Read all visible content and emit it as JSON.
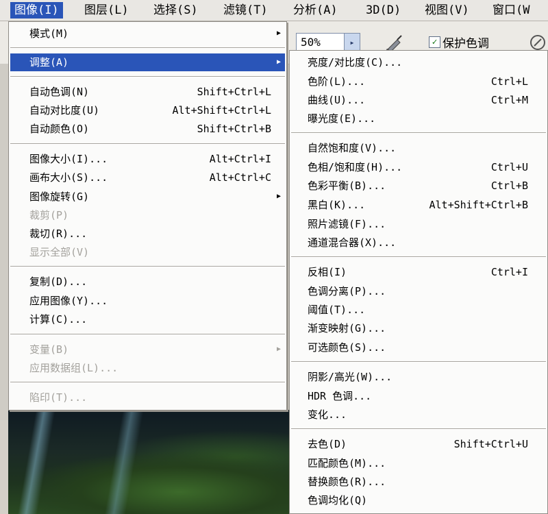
{
  "menubar": {
    "items": [
      "图像(I)",
      "图层(L)",
      "选择(S)",
      "滤镜(T)",
      "分析(A)",
      "3D(D)",
      "视图(V)",
      "窗口(W"
    ]
  },
  "toolbar": {
    "zoom_value": "50%",
    "zoom_arrow": "▸",
    "protect_tone_label": "保护色调",
    "protect_tone_checked": true,
    "check_glyph": "✓",
    "icons": [
      "airbrush-icon",
      "tablet-pressure-icon"
    ]
  },
  "image_menu": {
    "submenu_arrow": "▶",
    "items": [
      {
        "label": "模式(M)",
        "submenu": true
      },
      {
        "label": "调整(A)",
        "submenu": true,
        "highlighted": true
      },
      {
        "label": "自动色调(N)",
        "shortcut": "Shift+Ctrl+L"
      },
      {
        "label": "自动对比度(U)",
        "shortcut": "Alt+Shift+Ctrl+L"
      },
      {
        "label": "自动颜色(O)",
        "shortcut": "Shift+Ctrl+B"
      },
      {
        "label": "图像大小(I)...",
        "shortcut": "Alt+Ctrl+I"
      },
      {
        "label": "画布大小(S)...",
        "shortcut": "Alt+Ctrl+C"
      },
      {
        "label": "图像旋转(G)",
        "submenu": true
      },
      {
        "label": "裁剪(P)",
        "disabled": true
      },
      {
        "label": "裁切(R)..."
      },
      {
        "label": "显示全部(V)",
        "disabled": true
      },
      {
        "label": "复制(D)..."
      },
      {
        "label": "应用图像(Y)..."
      },
      {
        "label": "计算(C)..."
      },
      {
        "label": "变量(B)",
        "submenu": true,
        "disabled": true
      },
      {
        "label": "应用数据组(L)...",
        "disabled": true
      },
      {
        "label": "陷印(T)...",
        "disabled": true
      }
    ]
  },
  "adjust_submenu": {
    "items": [
      {
        "label": "亮度/对比度(C)..."
      },
      {
        "label": "色阶(L)...",
        "shortcut": "Ctrl+L"
      },
      {
        "label": "曲线(U)...",
        "shortcut": "Ctrl+M"
      },
      {
        "label": "曝光度(E)..."
      },
      {
        "label": "自然饱和度(V)..."
      },
      {
        "label": "色相/饱和度(H)...",
        "shortcut": "Ctrl+U"
      },
      {
        "label": "色彩平衡(B)...",
        "shortcut": "Ctrl+B"
      },
      {
        "label": "黑白(K)...",
        "shortcut": "Alt+Shift+Ctrl+B"
      },
      {
        "label": "照片滤镜(F)..."
      },
      {
        "label": "通道混合器(X)..."
      },
      {
        "label": "反相(I)",
        "shortcut": "Ctrl+I"
      },
      {
        "label": "色调分离(P)..."
      },
      {
        "label": "阈值(T)..."
      },
      {
        "label": "渐变映射(G)..."
      },
      {
        "label": "可选颜色(S)..."
      },
      {
        "label": "阴影/高光(W)..."
      },
      {
        "label": "HDR 色调..."
      },
      {
        "label": "变化..."
      },
      {
        "label": "去色(D)",
        "shortcut": "Shift+Ctrl+U"
      },
      {
        "label": "匹配颜色(M)..."
      },
      {
        "label": "替换颜色(R)..."
      },
      {
        "label": "色调均化(Q)"
      }
    ]
  },
  "colors": {
    "highlight": "#2a55b8",
    "menu_bg": "#fbfbfa",
    "disabled_text": "#a3a19c"
  }
}
